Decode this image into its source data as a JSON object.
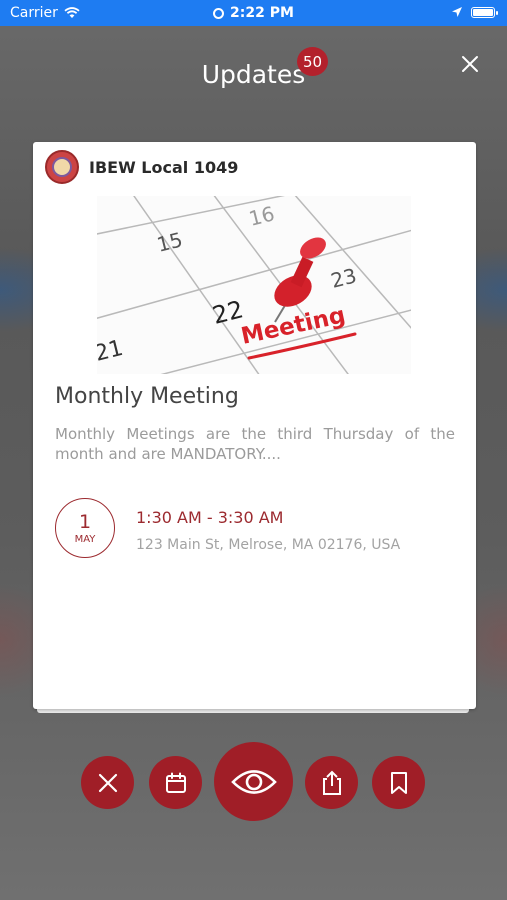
{
  "status_bar": {
    "carrier": "Carrier",
    "time": "2:22 PM"
  },
  "header": {
    "title": "Updates",
    "badge_count": "50"
  },
  "card": {
    "org_name": "IBEW Local 1049",
    "title": "Monthly Meeting",
    "description": "Monthly Meetings are the third Thursday of the month and are MANDATORY....",
    "event": {
      "day": "1",
      "month": "MAY",
      "time_range": "1:30 AM - 3:30 AM",
      "address": "123 Main St, Melrose, MA 02176, USA"
    },
    "image": {
      "numbers": [
        "15",
        "16",
        "21",
        "22",
        "23"
      ],
      "label": "Meeting"
    }
  },
  "actions": [
    {
      "icon": "close-icon"
    },
    {
      "icon": "calendar-icon"
    },
    {
      "icon": "eye-icon"
    },
    {
      "icon": "share-icon"
    },
    {
      "icon": "bookmark-icon"
    }
  ],
  "colors": {
    "status_bar": "#1e7cf2",
    "accent": "#a01e27",
    "badge": "#b3212c"
  }
}
